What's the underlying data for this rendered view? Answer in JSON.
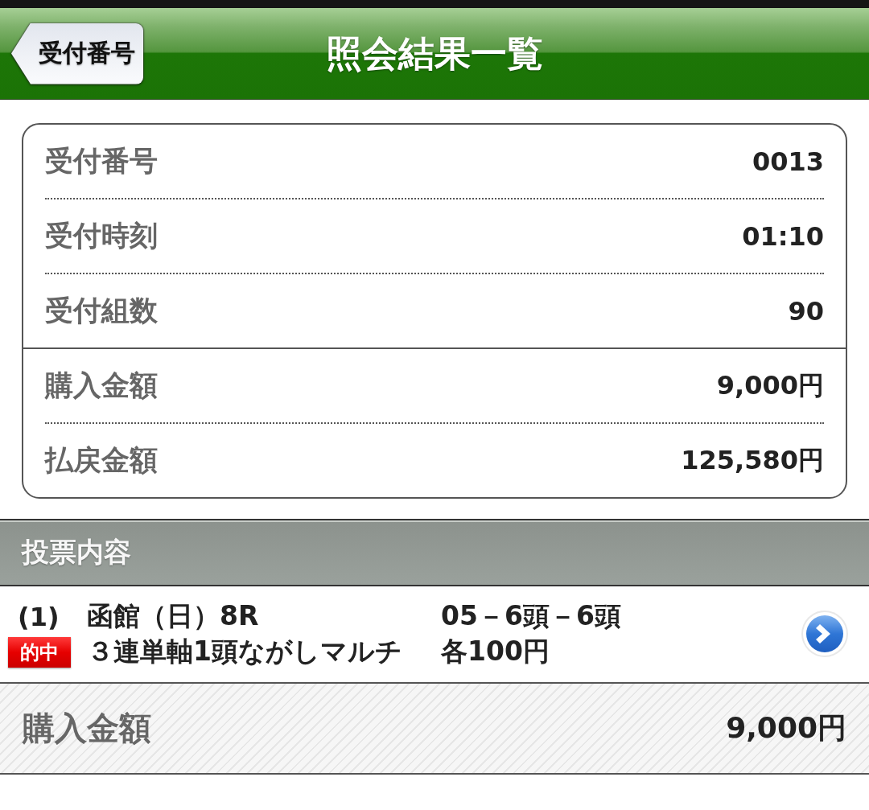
{
  "header": {
    "back_button": "受付番号",
    "title": "照会結果一覧"
  },
  "summary": {
    "sections": [
      {
        "rows": [
          {
            "label": "受付番号",
            "value": "0013"
          },
          {
            "label": "受付時刻",
            "value": "01:10"
          },
          {
            "label": "受付組数",
            "value": "90"
          }
        ]
      },
      {
        "rows": [
          {
            "label": "購入金額",
            "value": "9,000円"
          },
          {
            "label": "払戻金額",
            "value": "125,580円"
          }
        ]
      }
    ]
  },
  "bets": {
    "heading": "投票内容",
    "items": [
      {
        "number": "(1)",
        "badge": "的中",
        "venue": "函館（日）8R",
        "selection": "05－6頭－6頭",
        "bet_type": "３連単軸1頭ながしマルチ",
        "stake": "各100円"
      }
    ]
  },
  "total": {
    "label": "購入金額",
    "value": "9,000円"
  }
}
